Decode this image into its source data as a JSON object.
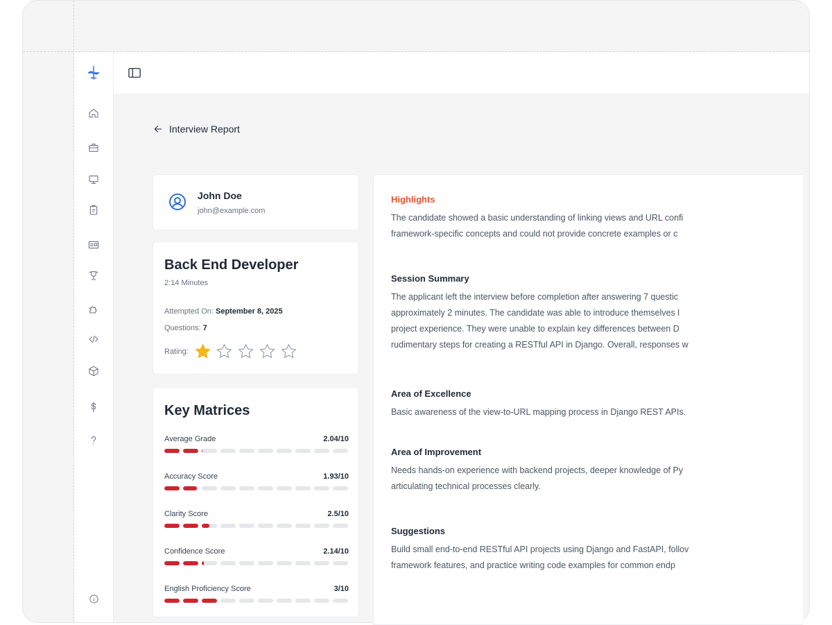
{
  "page": {
    "title": "Interview Report"
  },
  "candidate": {
    "name": "John Doe",
    "email": "john@example.com"
  },
  "role": {
    "title": "Back End Developer",
    "duration": "2:14 Minutes",
    "attempted_label": "Attempted On:",
    "attempted_value": "September 8, 2025",
    "questions_label": "Questions:",
    "questions_value": "7",
    "rating_label": "Rating:",
    "rating_value": 1,
    "rating_max": 5
  },
  "key_matrices": {
    "title": "Key Matrices",
    "metrics": [
      {
        "label": "Average Grade",
        "display": "2.04/10",
        "value": 2.04,
        "max": 10
      },
      {
        "label": "Accuracy Score",
        "display": "1.93/10",
        "value": 1.93,
        "max": 10
      },
      {
        "label": "Clarity Score",
        "display": "2.5/10",
        "value": 2.5,
        "max": 10
      },
      {
        "label": "Confidence Score",
        "display": "2.14/10",
        "value": 2.14,
        "max": 10
      },
      {
        "label": "English Proficiency Score",
        "display": "3/10",
        "value": 3,
        "max": 10
      }
    ]
  },
  "report": {
    "highlights": {
      "title": "Highlights",
      "lines": [
        "The candidate showed a basic understanding of linking views and URL confi",
        "framework-specific concepts and could not provide concrete examples or c"
      ]
    },
    "session_summary": {
      "title": "Session Summary",
      "lines": [
        "The applicant left the interview before completion after answering 7 questic",
        "approximately 2 minutes. The candidate was able to introduce themselves l",
        "project experience. They were unable to explain key differences between D",
        "rudimentary steps for creating a RESTful API in Django. Overall, responses w"
      ]
    },
    "area_of_excellence": {
      "title": "Area of Excellence",
      "lines": [
        "Basic awareness of the view-to-URL mapping process in Django REST APIs."
      ]
    },
    "area_of_improvement": {
      "title": "Area of Improvement",
      "lines": [
        "Needs hands-on experience with backend projects, deeper knowledge of Py",
        "articulating technical processes clearly."
      ]
    },
    "suggestions": {
      "title": "Suggestions",
      "lines": [
        "Build small end-to-end RESTful API projects using Django and FastAPI, follov",
        "framework features, and practice writing code examples for common endp"
      ]
    }
  },
  "icons": {
    "sidebar": [
      "logo-icon",
      "home-icon",
      "briefcase-icon",
      "monitor-icon",
      "clipboard-icon",
      "id-card-icon",
      "trophy-icon",
      "puzzle-icon",
      "code-icon",
      "box-icon",
      "dollar-icon",
      "help-icon",
      "info-icon"
    ],
    "accent": "#2f6fd6",
    "bar_fill": "#cf2530",
    "highlight": "#e4572e",
    "star": "#f5b51b"
  }
}
